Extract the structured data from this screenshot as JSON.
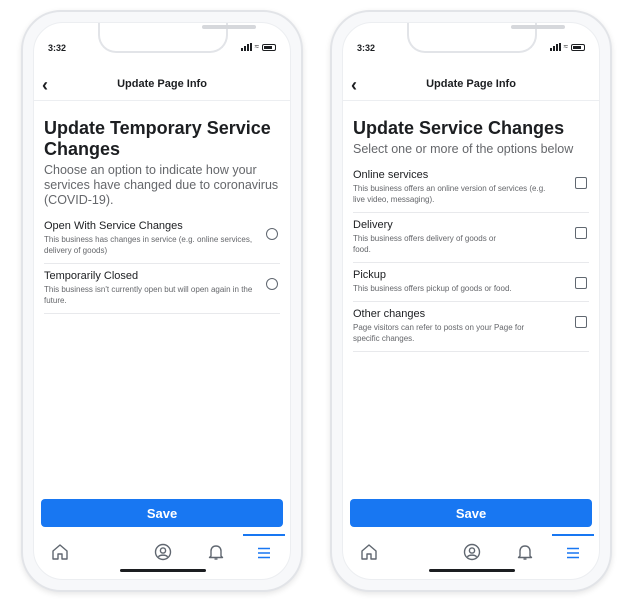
{
  "left": {
    "status_time": "3:32",
    "nav_title": "Update Page Info",
    "heading": "Update Temporary Service Changes",
    "subheading": "Choose an option to indicate how your services have changed due to coronavirus (COVID-19).",
    "options": [
      {
        "title": "Open With Service Changes",
        "desc": "This business has changes in service (e.g. online services, delivery of goods)"
      },
      {
        "title": "Temporarily Closed",
        "desc": "This business isn't currently open but will open again in the future."
      }
    ],
    "save_label": "Save"
  },
  "right": {
    "status_time": "3:32",
    "nav_title": "Update Page Info",
    "heading": "Update Service Changes",
    "subheading": "Select one or more of the options below",
    "options": [
      {
        "title": "Online services",
        "desc": "This business offers an online version of services (e.g. live video, messaging)."
      },
      {
        "title": "Delivery",
        "desc": "This business offers delivery of goods or food."
      },
      {
        "title": "Pickup",
        "desc": "This business offers pickup of goods or food."
      },
      {
        "title": "Other changes",
        "desc": "Page visitors can refer to posts on your Page for specific changes."
      }
    ],
    "save_label": "Save"
  },
  "tabs": [
    "home-icon",
    "profile-icon",
    "bell-icon",
    "menu-icon"
  ],
  "colors": {
    "accent": "#1877f2",
    "text": "#1c1e21",
    "secondary": "#65676b"
  }
}
